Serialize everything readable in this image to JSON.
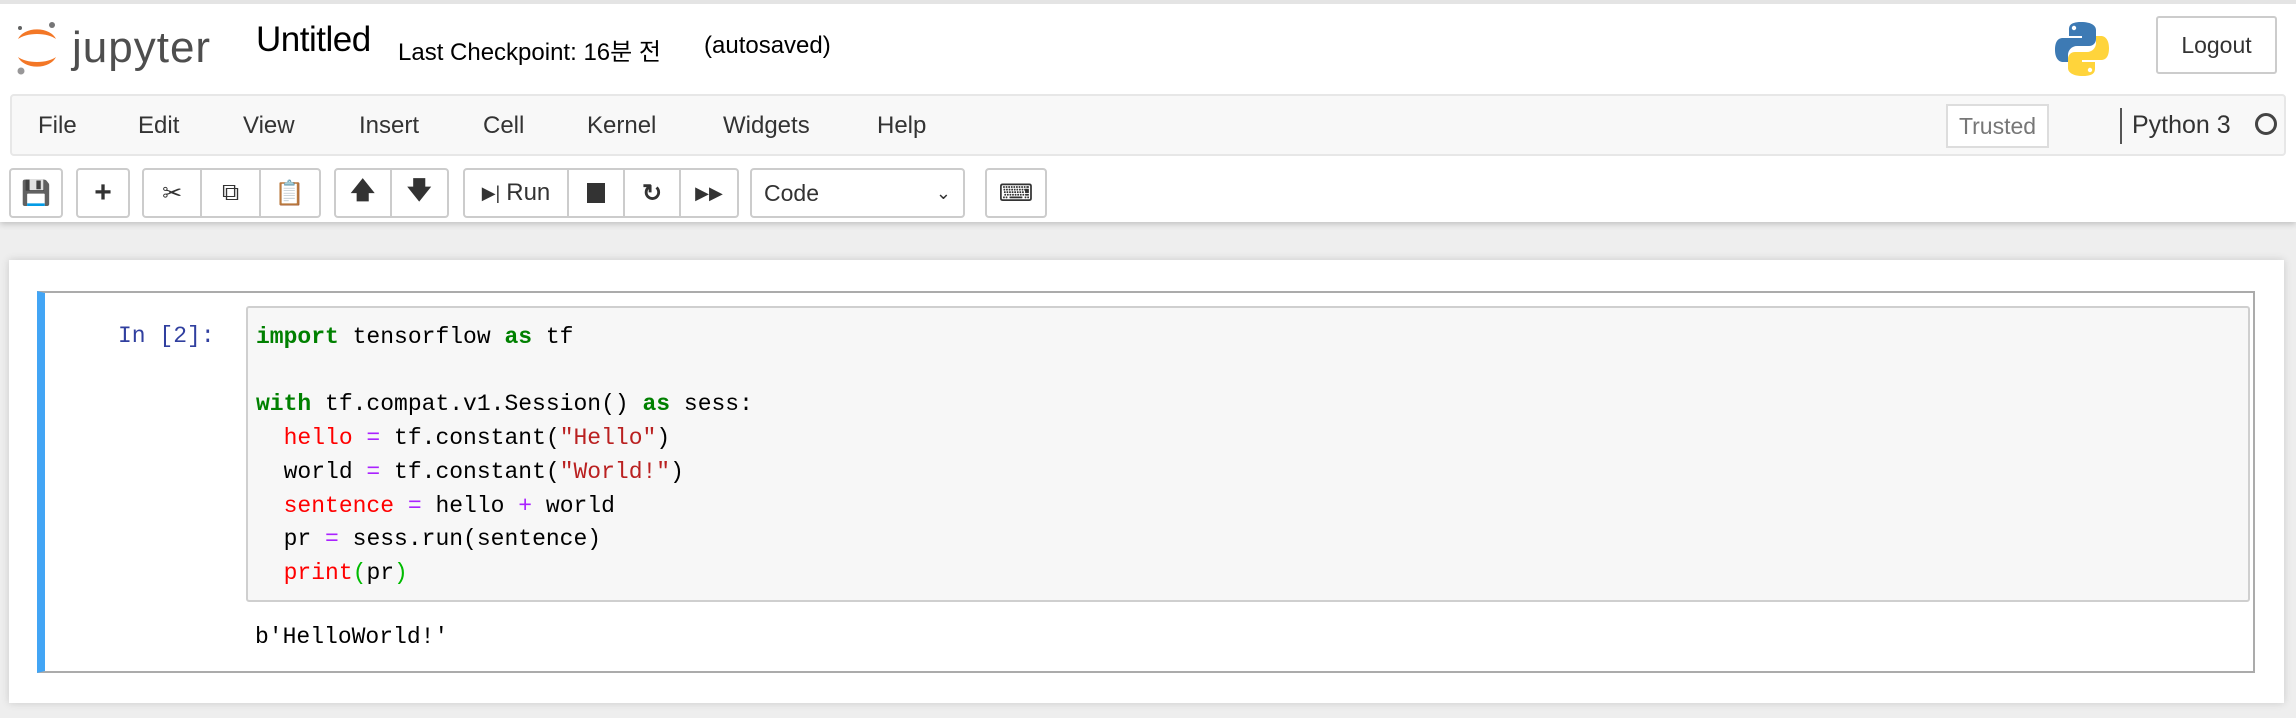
{
  "header": {
    "logo_text": "jupyter",
    "notebook_title": "Untitled",
    "checkpoint": "Last Checkpoint: 16분 전",
    "autosave": "(autosaved)",
    "logout_label": "Logout"
  },
  "menubar": {
    "items": [
      "File",
      "Edit",
      "View",
      "Insert",
      "Cell",
      "Kernel",
      "Widgets",
      "Help"
    ],
    "trusted": "Trusted",
    "kernel_name": "Python 3",
    "kernel_status": "idle"
  },
  "toolbar": {
    "run_label": "Run",
    "cell_type": "Code",
    "icons": [
      "save-icon",
      "plus-icon",
      "cut-icon",
      "copy-icon",
      "paste-icon",
      "arrow-up-icon",
      "arrow-down-icon",
      "step-forward-icon",
      "stop-icon",
      "restart-icon",
      "fast-forward-icon",
      "keyboard-icon"
    ]
  },
  "cell": {
    "prompt": "In [2]:",
    "code": {
      "l1": {
        "a": "import",
        "b": " tensorflow ",
        "c": "as",
        "d": " tf"
      },
      "l3": {
        "a": "with",
        "b": " tf.compat.v1.Session() ",
        "c": "as",
        "d": " sess:"
      },
      "l4": {
        "a": "hello",
        "b": " = ",
        "c": "tf.constant(",
        "d": "\"Hello\"",
        "e": ")"
      },
      "l5": {
        "a": "world",
        "b": " = ",
        "c": "tf.constant(",
        "d": "\"World!\"",
        "e": ")"
      },
      "l6": {
        "a": "sentence",
        "b": " = ",
        "c": "hello ",
        "d": "+",
        "e": " world"
      },
      "l7": {
        "a": "pr",
        "b": " = ",
        "c": "sess.run(sentence)"
      },
      "l8": {
        "a": "print",
        "b": "(",
        "c": "pr",
        "d": ")"
      }
    },
    "output": "b'HelloWorld!'"
  },
  "colors": {
    "accent": "#42a5f5",
    "keyword": "#008000",
    "string": "#ba2121",
    "operator": "#aa22ff"
  }
}
